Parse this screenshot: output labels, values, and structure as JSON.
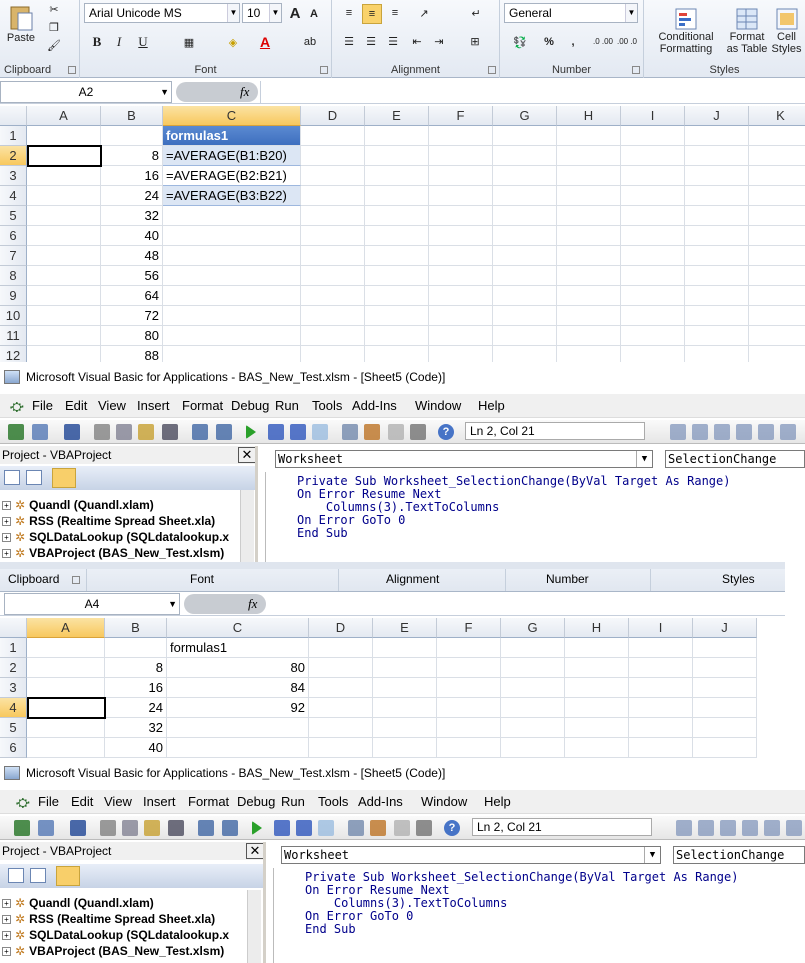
{
  "excel1": {
    "ribbon": {
      "paste_label": "Paste",
      "font_name": "Arial Unicode MS",
      "font_size": "10",
      "number_format": "General",
      "group_clipboard": "Clipboard",
      "group_font": "Font",
      "group_alignment": "Alignment",
      "group_number": "Number",
      "group_styles": "Styles",
      "conditional_formatting": "Conditional Formatting",
      "format_as_table": "Format as Table",
      "cell_styles": "Cell Styles",
      "bold": "B",
      "italic": "I",
      "underline": "U",
      "grow_font": "A",
      "shrink_font": "A",
      "percent": "%",
      "comma": ",",
      "inc_decimal": ".0 .00",
      "dec_decimal": ".00 .0",
      "fx": "fx"
    },
    "name_box": "A2",
    "columns": [
      "A",
      "B",
      "C",
      "D",
      "E",
      "F",
      "G",
      "H",
      "I",
      "J",
      "K"
    ],
    "rows": [
      {
        "r": "1",
        "b": "",
        "c": "formulas1"
      },
      {
        "r": "2",
        "b": "8",
        "c": "=AVERAGE(B1:B20)"
      },
      {
        "r": "3",
        "b": "16",
        "c": "=AVERAGE(B2:B21)"
      },
      {
        "r": "4",
        "b": "24",
        "c": "=AVERAGE(B3:B22)"
      },
      {
        "r": "5",
        "b": "32",
        "c": ""
      },
      {
        "r": "6",
        "b": "40",
        "c": ""
      },
      {
        "r": "7",
        "b": "48",
        "c": ""
      },
      {
        "r": "8",
        "b": "56",
        "c": ""
      },
      {
        "r": "9",
        "b": "64",
        "c": ""
      },
      {
        "r": "10",
        "b": "72",
        "c": ""
      },
      {
        "r": "11",
        "b": "80",
        "c": ""
      },
      {
        "r": "12",
        "b": "88",
        "c": ""
      }
    ]
  },
  "vba1": {
    "title": "Microsoft Visual Basic for Applications - BAS_New_Test.xlsm - [Sheet5 (Code)]",
    "menus": [
      "File",
      "Edit",
      "View",
      "Insert",
      "Format",
      "Debug",
      "Run",
      "Tools",
      "Add-Ins",
      "Window",
      "Help"
    ],
    "position": "Ln 2, Col 21",
    "project_title": "Project - VBAProject",
    "tree": [
      "Quandl (Quandl.xlam)",
      "RSS (Realtime Spread Sheet.xla)",
      "SQLDataLookup (SQLdatalookup.x",
      "VBAProject (BAS_New_Test.xlsm)"
    ],
    "object_combo": "Worksheet",
    "proc_combo": "SelectionChange",
    "code": [
      "Private Sub Worksheet_SelectionChange(ByVal Target As Range)",
      "On Error Resume Next",
      "    Columns(3).TextToColumns",
      "On Error GoTo 0",
      "End Sub"
    ]
  },
  "excel2": {
    "group_clipboard": "Clipboard",
    "group_font": "Font",
    "group_alignment": "Alignment",
    "group_number": "Number",
    "group_styles": "Styles",
    "name_box": "A4",
    "fx": "fx",
    "columns": [
      "A",
      "B",
      "C",
      "D",
      "E",
      "F",
      "G",
      "H",
      "I",
      "J"
    ],
    "rows": [
      {
        "r": "1",
        "b": "",
        "c": "formulas1"
      },
      {
        "r": "2",
        "b": "8",
        "c": "80"
      },
      {
        "r": "3",
        "b": "16",
        "c": "84"
      },
      {
        "r": "4",
        "b": "24",
        "c": "92"
      },
      {
        "r": "5",
        "b": "32",
        "c": ""
      },
      {
        "r": "6",
        "b": "40",
        "c": ""
      }
    ]
  },
  "vba2": {
    "title": "Microsoft Visual Basic for Applications - BAS_New_Test.xlsm - [Sheet5 (Code)]",
    "menus": [
      "File",
      "Edit",
      "View",
      "Insert",
      "Format",
      "Debug",
      "Run",
      "Tools",
      "Add-Ins",
      "Window",
      "Help"
    ],
    "position": "Ln 2, Col 21",
    "project_title": "Project - VBAProject",
    "tree": [
      "Quandl (Quandl.xlam)",
      "RSS (Realtime Spread Sheet.xla)",
      "SQLDataLookup (SQLdatalookup.x",
      "VBAProject (BAS_New_Test.xlsm)"
    ],
    "object_combo": "Worksheet",
    "proc_combo": "SelectionChange",
    "code": [
      "Private Sub Worksheet_SelectionChange(ByVal Target As Range)",
      "On Error Resume Next",
      "    Columns(3).TextToColumns",
      "On Error GoTo 0",
      "End Sub"
    ]
  }
}
